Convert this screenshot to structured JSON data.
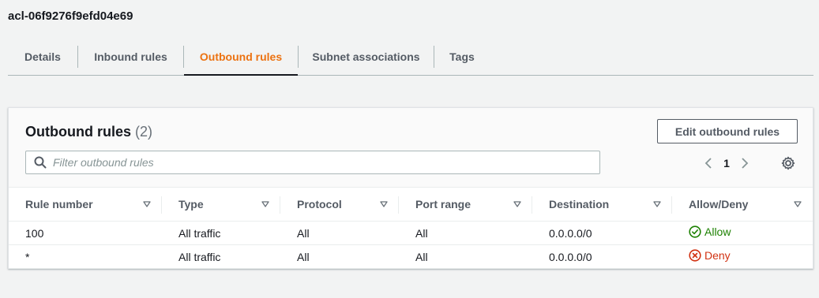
{
  "acl_id": "acl-06f9276f9efd04e69",
  "tabs": [
    {
      "label": "Details",
      "active": false
    },
    {
      "label": "Inbound rules",
      "active": false
    },
    {
      "label": "Outbound rules",
      "active": true
    },
    {
      "label": "Subnet associations",
      "active": false
    },
    {
      "label": "Tags",
      "active": false
    }
  ],
  "panel": {
    "title": "Outbound rules",
    "count": "(2)",
    "edit_button": "Edit outbound rules",
    "filter_placeholder": "Filter outbound rules",
    "filter_value": "",
    "current_page": "1"
  },
  "table": {
    "columns": [
      "Rule number",
      "Type",
      "Protocol",
      "Port range",
      "Destination",
      "Allow/Deny"
    ],
    "rows": [
      {
        "rule_number": "100",
        "type": "All traffic",
        "protocol": "All",
        "port_range": "All",
        "destination": "0.0.0.0/0",
        "action": "Allow",
        "action_status": "allow"
      },
      {
        "rule_number": "*",
        "type": "All traffic",
        "protocol": "All",
        "port_range": "All",
        "destination": "0.0.0.0/0",
        "action": "Deny",
        "action_status": "deny"
      }
    ]
  },
  "colors": {
    "accent": "#ec7211",
    "allow": "#1d8102",
    "deny": "#d13212",
    "background": "#f2f3f3"
  },
  "icons": {
    "search": "search-icon",
    "sort": "sort-down-icon",
    "prev": "chevron-left-icon",
    "next": "chevron-right-icon",
    "settings": "gear-icon",
    "allow": "check-circle-icon",
    "deny": "x-circle-icon"
  }
}
